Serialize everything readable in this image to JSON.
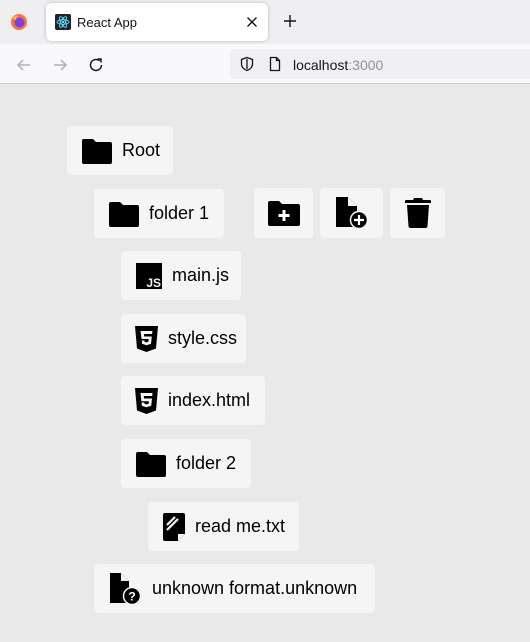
{
  "browser": {
    "tab_title": "React App",
    "url_host": "localhost",
    "url_port": ":3000",
    "icons": [
      "firefox-logo",
      "react-favicon",
      "close-icon",
      "plus-icon",
      "back-arrow-icon",
      "forward-arrow-icon",
      "reload-icon",
      "shield-icon",
      "page-icon"
    ]
  },
  "tree": {
    "root": {
      "label": "Root",
      "icon": "folder-icon"
    },
    "folder1": {
      "label": "folder 1",
      "icon": "folder-icon"
    },
    "actions": [
      {
        "name": "add-folder",
        "icon": "folder-plus-icon"
      },
      {
        "name": "add-file",
        "icon": "file-plus-icon"
      },
      {
        "name": "delete",
        "icon": "trash-icon"
      }
    ],
    "main_js": {
      "label": "main.js",
      "icon": "js-icon"
    },
    "style_css": {
      "label": "style.css",
      "icon": "css3-icon"
    },
    "index_html": {
      "label": "index.html",
      "icon": "html5-icon"
    },
    "folder2": {
      "label": "folder 2",
      "icon": "folder-icon"
    },
    "readme": {
      "label": "read me.txt",
      "icon": "text-file-icon"
    },
    "unknown": {
      "label": "unknown format.unknown",
      "icon": "file-question-icon"
    }
  }
}
